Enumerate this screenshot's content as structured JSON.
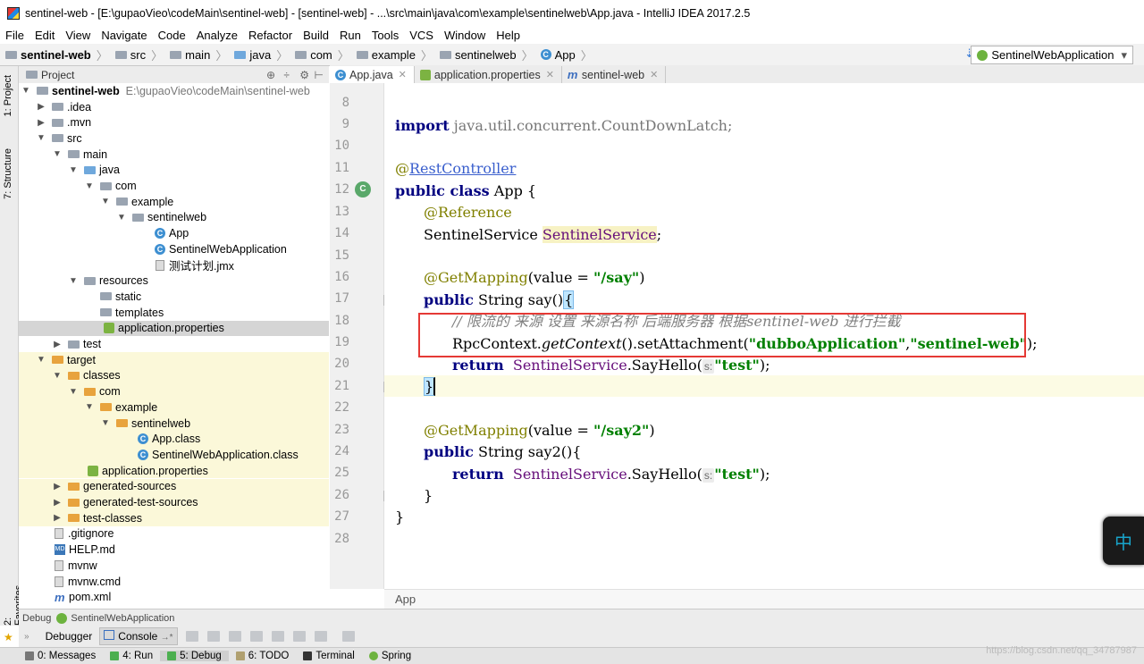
{
  "window": {
    "title": "sentinel-web - [E:\\gupaoVieo\\codeMain\\sentinel-web] - [sentinel-web] - ...\\src\\main\\java\\com\\example\\sentinelweb\\App.java - IntelliJ IDEA 2017.2.5"
  },
  "menu": [
    "File",
    "Edit",
    "View",
    "Navigate",
    "Code",
    "Analyze",
    "Refactor",
    "Build",
    "Run",
    "Tools",
    "VCS",
    "Window",
    "Help"
  ],
  "breadcrumbs": [
    "sentinel-web",
    "src",
    "main",
    "java",
    "com",
    "example",
    "sentinelweb",
    "App"
  ],
  "run_config": "SentinelWebApplication",
  "left_strip": {
    "project": "1: Project",
    "structure": "7: Structure",
    "favorites": "2: Favorites"
  },
  "project_panel": {
    "header": "Project",
    "tree": [
      {
        "label": "sentinel-web",
        "path": "E:\\gupaoVieo\\codeMain\\sentinel-web"
      },
      {
        "label": ".idea"
      },
      {
        "label": ".mvn"
      },
      {
        "label": "src"
      },
      {
        "label": "main"
      },
      {
        "label": "java"
      },
      {
        "label": "com"
      },
      {
        "label": "example"
      },
      {
        "label": "sentinelweb"
      },
      {
        "label": "App"
      },
      {
        "label": "SentinelWebApplication"
      },
      {
        "label": "测试计划.jmx"
      },
      {
        "label": "resources"
      },
      {
        "label": "static"
      },
      {
        "label": "templates"
      },
      {
        "label": "application.properties"
      },
      {
        "label": "test"
      },
      {
        "label": "target"
      },
      {
        "label": "classes"
      },
      {
        "label": "com"
      },
      {
        "label": "example"
      },
      {
        "label": "sentinelweb"
      },
      {
        "label": "App.class"
      },
      {
        "label": "SentinelWebApplication.class"
      },
      {
        "label": "application.properties"
      },
      {
        "label": "generated-sources"
      },
      {
        "label": "generated-test-sources"
      },
      {
        "label": "test-classes"
      },
      {
        "label": ".gitignore"
      },
      {
        "label": "HELP.md"
      },
      {
        "label": "mvnw"
      },
      {
        "label": "mvnw.cmd"
      },
      {
        "label": "pom.xml"
      }
    ]
  },
  "tabs": [
    "App.java",
    "application.properties",
    "sentinel-web"
  ],
  "editor": {
    "line_numbers": [
      "8",
      "9",
      "10",
      "11",
      "12",
      "13",
      "14",
      "15",
      "16",
      "17",
      "18",
      "19",
      "20",
      "21",
      "22",
      "23",
      "24",
      "25",
      "26",
      "27",
      "28"
    ],
    "code": {
      "l9_kw": "import",
      "l9_rest": " java.util.concurrent.CountDownLatch;",
      "l11_at": "@",
      "l11_ann": "RestController",
      "l12_kw": "public class",
      "l12_rest": " App {",
      "l13": "@Reference",
      "l14_type": "SentinelService ",
      "l14_field": "SentinelService",
      "l14_end": ";",
      "l16_ann": "@GetMapping",
      "l16_mid": "(value = ",
      "l16_str": "\"/say\"",
      "l16_end": ")",
      "l17_kw": "public",
      "l17_rest": " String say()",
      "l17_brace": "{",
      "l18": "// 限流的 来源 设置 来源名称 后端服务器 根据sentinel-web 进行拦截",
      "l19_a": "RpcContext.",
      "l19_b": "getContext",
      "l19_c": "().setAttachment(",
      "l19_s1": "\"dubboApplication\"",
      "l19_d": ",",
      "l19_s2": "\"sentinel-web\"",
      "l19_e": ");",
      "l20_kw": "return",
      "l20_f": "  SentinelService",
      "l20_m": ".SayHello(",
      "l20_hint": "s:",
      "l20_s": "\"test\"",
      "l20_e": ");",
      "l21": "}",
      "l23_ann": "@GetMapping",
      "l23_mid": "(value = ",
      "l23_str": "\"/say2\"",
      "l23_end": ")",
      "l24_kw": "public",
      "l24_rest": " String say2(){",
      "l25_kw": "return",
      "l25_f": "  SentinelService",
      "l25_m": ".SayHello(",
      "l25_hint": "s:",
      "l25_s": "\"test\"",
      "l25_e": ");",
      "l26": "}",
      "l27": "}"
    },
    "footer": "App"
  },
  "debug": {
    "label": "Debug",
    "config": "SentinelWebApplication",
    "tabs": [
      "Debugger",
      "Console"
    ]
  },
  "bottom_tabs": [
    "0: Messages",
    "4: Run",
    "5: Debug",
    "6: TODO",
    "Terminal",
    "Spring"
  ],
  "ime": "中",
  "watermark": "https://blog.csdn.net/qq_34787987"
}
